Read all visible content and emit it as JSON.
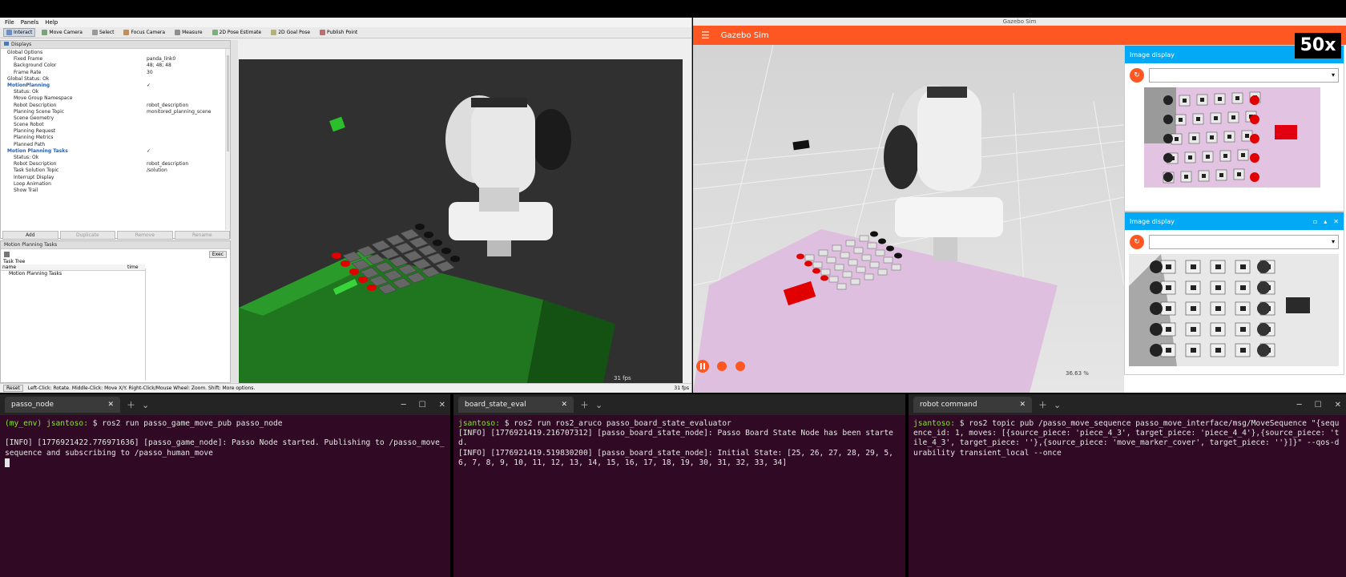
{
  "rviz": {
    "menu": [
      "File",
      "Panels",
      "Help"
    ],
    "toolbar": [
      {
        "label": "Interact",
        "icon": "interact-icon",
        "active": true
      },
      {
        "label": "Move Camera",
        "icon": "move-camera-icon"
      },
      {
        "label": "Select",
        "icon": "select-icon"
      },
      {
        "label": "Focus Camera",
        "icon": "focus-camera-icon"
      },
      {
        "label": "Measure",
        "icon": "measure-icon"
      },
      {
        "label": "2D Pose Estimate",
        "icon": "pose-estimate-icon"
      },
      {
        "label": "2D Goal Pose",
        "icon": "goal-pose-icon"
      },
      {
        "label": "Publish Point",
        "icon": "publish-point-icon"
      }
    ],
    "displays_title": "Displays",
    "displays": [
      {
        "label": "Global Options",
        "value": "",
        "indent": 1,
        "blue": false
      },
      {
        "label": "Fixed Frame",
        "value": "panda_link0",
        "indent": 2,
        "blue": false
      },
      {
        "label": "Background Color",
        "value": "48; 48; 48",
        "indent": 2,
        "blue": false
      },
      {
        "label": "Frame Rate",
        "value": "30",
        "indent": 2,
        "blue": false
      },
      {
        "label": "Global Status: Ok",
        "value": "",
        "indent": 1,
        "blue": false
      },
      {
        "label": "MotionPlanning",
        "value": "✓",
        "indent": 1,
        "blue": true
      },
      {
        "label": "Status: Ok",
        "value": "",
        "indent": 2,
        "blue": false
      },
      {
        "label": "Move Group Namespace",
        "value": "",
        "indent": 2,
        "blue": false
      },
      {
        "label": "Robot Description",
        "value": "robot_description",
        "indent": 2,
        "blue": false
      },
      {
        "label": "Planning Scene Topic",
        "value": "monitored_planning_scene",
        "indent": 2,
        "blue": false
      },
      {
        "label": "Scene Geometry",
        "value": "",
        "indent": 2,
        "blue": false
      },
      {
        "label": "Scene Robot",
        "value": "",
        "indent": 2,
        "blue": false
      },
      {
        "label": "Planning Request",
        "value": "",
        "indent": 2,
        "blue": false
      },
      {
        "label": "Planning Metrics",
        "value": "",
        "indent": 2,
        "blue": false
      },
      {
        "label": "Planned Path",
        "value": "",
        "indent": 2,
        "blue": false
      },
      {
        "label": "Motion Planning Tasks",
        "value": "✓",
        "indent": 1,
        "blue": true
      },
      {
        "label": "Status: Ok",
        "value": "",
        "indent": 2,
        "blue": false
      },
      {
        "label": "Robot Description",
        "value": "robot_description",
        "indent": 2,
        "blue": false
      },
      {
        "label": "Task Solution Topic",
        "value": "/solution",
        "indent": 2,
        "blue": false
      },
      {
        "label": "Interrupt Display",
        "value": "",
        "indent": 2,
        "blue": false
      },
      {
        "label": "Loop Animation",
        "value": "",
        "indent": 2,
        "blue": false
      },
      {
        "label": "Show Trail",
        "value": "",
        "indent": 2,
        "blue": false
      }
    ],
    "display_buttons": [
      {
        "label": "Add",
        "enabled": true
      },
      {
        "label": "Duplicate",
        "enabled": false
      },
      {
        "label": "Remove",
        "enabled": false
      },
      {
        "label": "Rename",
        "enabled": false
      }
    ],
    "mpt_title": "Motion Planning Tasks",
    "exec_label": "Exec",
    "task_tree_label": "Task Tree",
    "col_name": "name",
    "col_time": "time",
    "tree_item": "Motion Planning Tasks",
    "reset_label": "Reset",
    "status_text": "Left-Click: Rotate. Middle-Click: Move X/Y. Right-Click/Mouse Wheel: Zoom. Shift: More options.",
    "fps": "31 fps",
    "bg_color": "#303030"
  },
  "gazebo": {
    "window_title": "Gazebo Sim",
    "app_title": "Gazebo Sim",
    "accent": "#ff5722",
    "panel_accent": "#03a9f4",
    "image_display_title": "Image display",
    "zoom": "36.63 %"
  },
  "badge": "50x",
  "terminals": [
    {
      "tab": "passo_node",
      "lines": [
        {
          "prompt": "(my_env) jsantoso:",
          "text": " $ ros2 run passo_game_move_pub passo_node"
        },
        {
          "prompt": "",
          "text": ""
        },
        {
          "prompt": "",
          "text": "[INFO] [1776921422.776971636] [passo_game_node]: Passo Node started. Publishing to /passo_move_sequence and subscribing to /passo_human_move"
        }
      ]
    },
    {
      "tab": "board_state_eval",
      "lines": [
        {
          "prompt": "jsantoso:",
          "text": " $ ros2 run ros2_aruco passo_board_state_evaluator"
        },
        {
          "prompt": "",
          "text": "[INFO] [1776921419.216707312] [passo_board_state_node]: Passo Board State Node has been started."
        },
        {
          "prompt": "",
          "text": "[INFO] [1776921419.519830200] [passo_board_state_node]: Initial State: [25, 26, 27, 28, 29, 5, 6, 7, 8, 9, 10, 11, 12, 13, 14, 15, 16, 17, 18, 19, 30, 31, 32, 33, 34]"
        }
      ]
    },
    {
      "tab": "robot command",
      "lines": [
        {
          "prompt": "jsantoso:",
          "text": " $ ros2 topic pub /passo_move_sequence passo_move_interface/msg/MoveSequence \"{sequence_id: 1, moves: [{source_piece: 'piece_4_3', target_piece: 'piece_4_4'},{source_piece: 'tile_4_3', target_piece: ''},{source_piece: 'move_marker_cover', target_piece: ''}]}\" --qos-durability transient_local --once"
        }
      ]
    }
  ]
}
